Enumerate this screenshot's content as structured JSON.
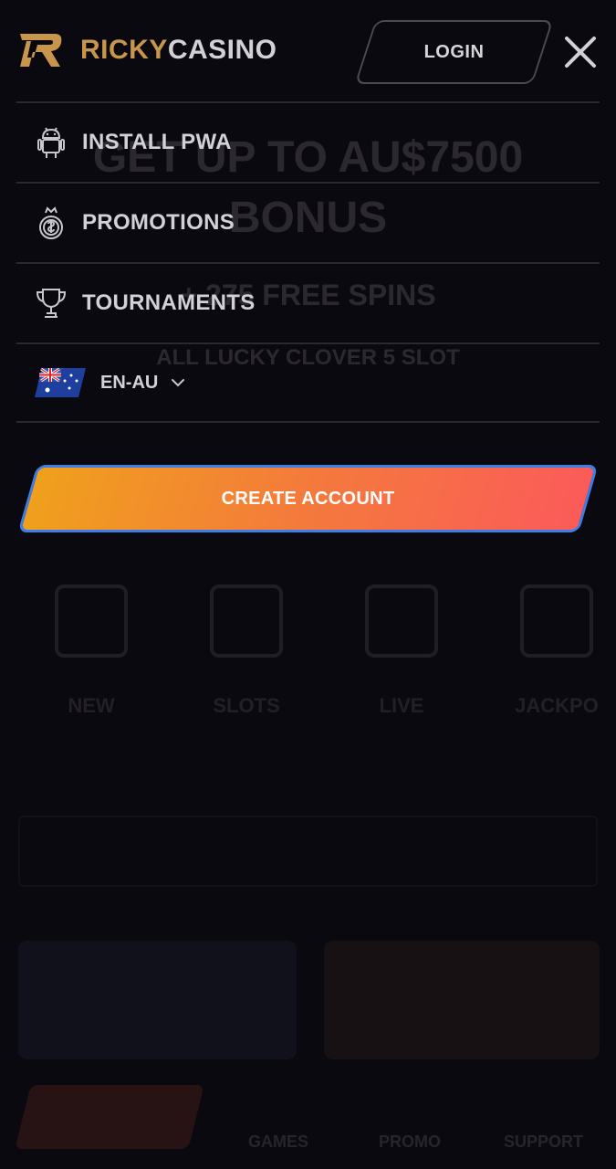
{
  "header": {
    "logo_part1": "RICKY",
    "logo_part2": "CASINO",
    "login_label": "LOGIN"
  },
  "menu": {
    "items": [
      {
        "label": "INSTALL PWA",
        "icon": "android-icon"
      },
      {
        "label": "PROMOTIONS",
        "icon": "coin-stack-icon"
      },
      {
        "label": "TOURNAMENTS",
        "icon": "trophy-icon"
      }
    ],
    "language": {
      "label": "EN-AU",
      "flag": "australia-flag-icon"
    }
  },
  "cta": {
    "create_account_label": "CREATE ACCOUNT"
  },
  "background": {
    "hero_title_line1": "GET UP TO AU$7500",
    "hero_title_line2": "BONUS",
    "hero_spins": "+ 275 FREE SPINS",
    "hero_sub": "ALL LUCKY CLOVER 5 SLOT",
    "categories": [
      "NEW",
      "SLOTS",
      "LIVE",
      "JACKPO"
    ],
    "bottom_tabs": [
      "GAMES",
      "PROMO",
      "SUPPORT"
    ]
  },
  "colors": {
    "background": "#0b0910",
    "brand_gold": "#c8964a",
    "cta_gradient_start": "#f0a01c",
    "cta_gradient_end": "#fb5b59",
    "cta_border": "#3b7ee8"
  }
}
